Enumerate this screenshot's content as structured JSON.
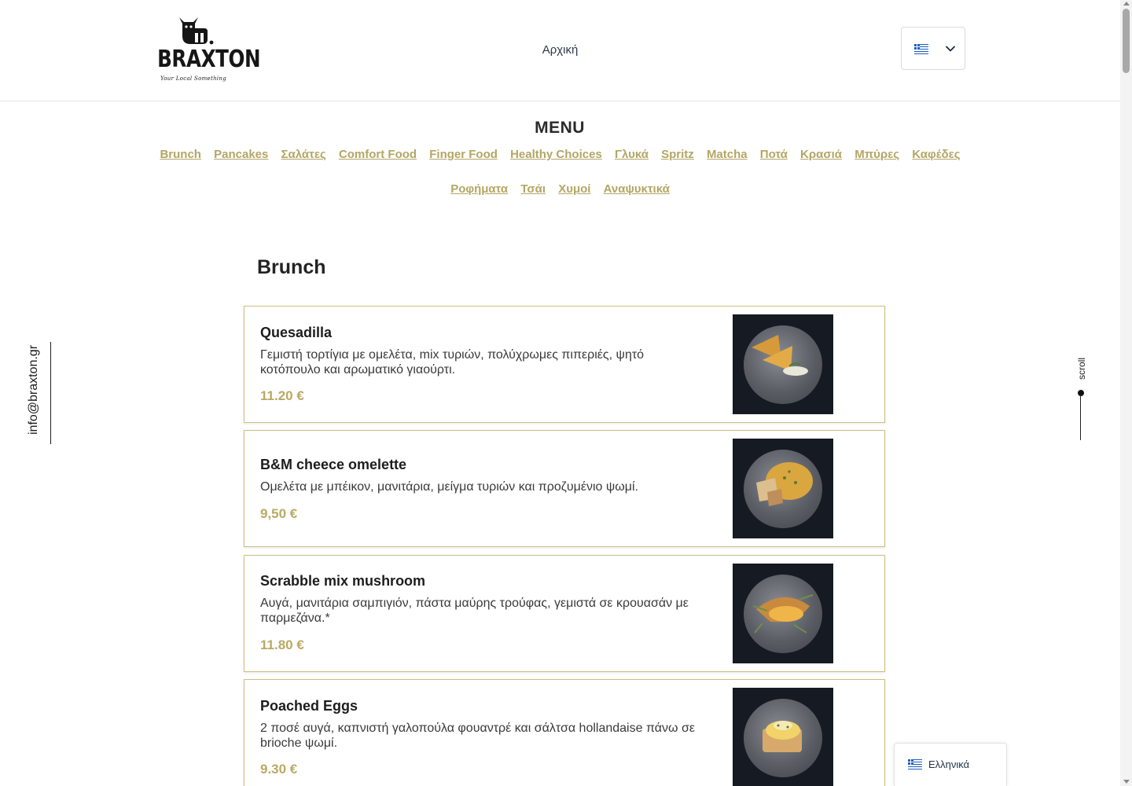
{
  "header": {
    "logo": {
      "brand": "BRAXTON",
      "tagline": "Your Local Something"
    },
    "nav_home": "Αρχική",
    "language_select": {
      "flag_icon": "greek-flag-icon",
      "chevron_icon": "chevron-down-icon"
    }
  },
  "menu": {
    "title": "MENU",
    "categories_row1": [
      "Brunch",
      "Pancakes",
      "Σαλάτες",
      "Comfort Food",
      "Finger Food",
      "Healthy Choices",
      "Γλυκά",
      "Spritz",
      "Matcha",
      "Ποτά",
      "Κρασιά",
      "Μπύρες",
      "Καφέδες"
    ],
    "categories_row2": [
      "Ροφήματα",
      "Τσάι",
      "Χυμοί",
      "Αναψυκτικά"
    ]
  },
  "section": {
    "title": "Brunch",
    "items": [
      {
        "name": "Quesadilla",
        "description": "Γεμιστή τορτίγια με ομελέτα, mix τυριών, πολύχρωμες πιπεριές, ψητό κοτόπουλο και αρωματικό γιαούρτι.",
        "price": "11.20 €"
      },
      {
        "name": "B&M cheece omelette",
        "description": "Ομελέτα με μπέικον, μανιτάρια, μείγμα τυριών και προζυμένιο ψωμί.",
        "price": "9,50 €"
      },
      {
        "name": "Scrabble mix mushroom",
        "description": "Αυγά, μανιτάρια σαμπιγιόν, πάστα μαύρης τρούφας, γεμιστά σε κρουασάν με παρμεζάνα.*",
        "price": "11.80 €"
      },
      {
        "name": "Poached Eggs",
        "description": "2 ποσέ αυγά, καπνιστή γαλοπούλα φουαντρέ και σάλτσα hollandaise πάνω σε brioche ψωμί.",
        "price": "9.30 €"
      }
    ]
  },
  "side": {
    "email": "info@braxton.gr",
    "scroll_label": "scroll"
  },
  "language_widget": {
    "label": "Ελληνικά"
  },
  "colors": {
    "accent": "#b4a665",
    "card_border": "#cbbf85",
    "price": "#b9a964",
    "text": "#1f1f1f"
  }
}
